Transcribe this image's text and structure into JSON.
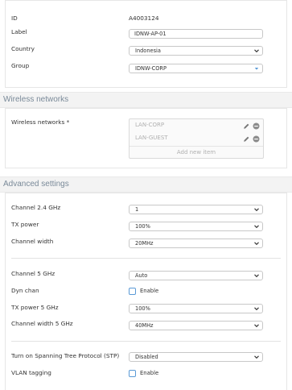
{
  "general": {
    "id_label": "ID",
    "id_value": "A4003124",
    "label_label": "Label",
    "label_value": "IDNW-AP-01",
    "country_label": "Country",
    "country_value": "Indonesia",
    "group_label": "Group",
    "group_value": "IDNW-CORP"
  },
  "wireless": {
    "section_title": "Wireless networks",
    "field_label": "Wireless networks *",
    "networks": [
      "LAN-CORP",
      "LAN-GUEST"
    ],
    "add_new": "Add new item"
  },
  "advanced": {
    "section_title": "Advanced settings",
    "channel_24_label": "Channel 2.4 GHz",
    "channel_24_value": "1",
    "tx_power_label": "TX power",
    "tx_power_value": "100%",
    "channel_width_label": "Channel width",
    "channel_width_value": "20MHz",
    "channel_5_label": "Channel 5 GHz",
    "channel_5_value": "Auto",
    "dyn_chan_label": "Dyn chan",
    "dyn_chan_checkbox": "Enable",
    "tx_power_5_label": "TX power 5 GHz",
    "tx_power_5_value": "100%",
    "channel_width_5_label": "Channel width 5 GHz",
    "channel_width_5_value": "40MHz",
    "stp_label": "Turn on Spanning Tree Protocol (STP)",
    "stp_value": "Disabled",
    "vlan_label": "VLAN tagging",
    "vlan_checkbox": "Enable"
  },
  "colors": {
    "accent": "#5a9ad6",
    "section_title": "#7a8a99",
    "section_bg": "#f3f3f3"
  }
}
